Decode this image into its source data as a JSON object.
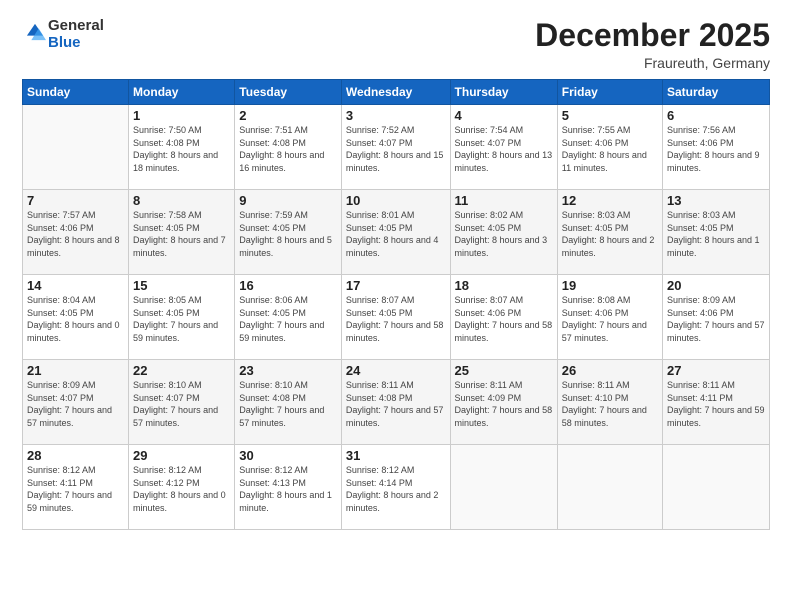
{
  "logo": {
    "general": "General",
    "blue": "Blue"
  },
  "header": {
    "month": "December 2025",
    "location": "Fraureuth, Germany"
  },
  "weekdays": [
    "Sunday",
    "Monday",
    "Tuesday",
    "Wednesday",
    "Thursday",
    "Friday",
    "Saturday"
  ],
  "weeks": [
    [
      {
        "day": "",
        "info": ""
      },
      {
        "day": "1",
        "info": "Sunrise: 7:50 AM\nSunset: 4:08 PM\nDaylight: 8 hours\nand 18 minutes."
      },
      {
        "day": "2",
        "info": "Sunrise: 7:51 AM\nSunset: 4:08 PM\nDaylight: 8 hours\nand 16 minutes."
      },
      {
        "day": "3",
        "info": "Sunrise: 7:52 AM\nSunset: 4:07 PM\nDaylight: 8 hours\nand 15 minutes."
      },
      {
        "day": "4",
        "info": "Sunrise: 7:54 AM\nSunset: 4:07 PM\nDaylight: 8 hours\nand 13 minutes."
      },
      {
        "day": "5",
        "info": "Sunrise: 7:55 AM\nSunset: 4:06 PM\nDaylight: 8 hours\nand 11 minutes."
      },
      {
        "day": "6",
        "info": "Sunrise: 7:56 AM\nSunset: 4:06 PM\nDaylight: 8 hours\nand 9 minutes."
      }
    ],
    [
      {
        "day": "7",
        "info": "Sunrise: 7:57 AM\nSunset: 4:06 PM\nDaylight: 8 hours\nand 8 minutes."
      },
      {
        "day": "8",
        "info": "Sunrise: 7:58 AM\nSunset: 4:05 PM\nDaylight: 8 hours\nand 7 minutes."
      },
      {
        "day": "9",
        "info": "Sunrise: 7:59 AM\nSunset: 4:05 PM\nDaylight: 8 hours\nand 5 minutes."
      },
      {
        "day": "10",
        "info": "Sunrise: 8:01 AM\nSunset: 4:05 PM\nDaylight: 8 hours\nand 4 minutes."
      },
      {
        "day": "11",
        "info": "Sunrise: 8:02 AM\nSunset: 4:05 PM\nDaylight: 8 hours\nand 3 minutes."
      },
      {
        "day": "12",
        "info": "Sunrise: 8:03 AM\nSunset: 4:05 PM\nDaylight: 8 hours\nand 2 minutes."
      },
      {
        "day": "13",
        "info": "Sunrise: 8:03 AM\nSunset: 4:05 PM\nDaylight: 8 hours\nand 1 minute."
      }
    ],
    [
      {
        "day": "14",
        "info": "Sunrise: 8:04 AM\nSunset: 4:05 PM\nDaylight: 8 hours\nand 0 minutes."
      },
      {
        "day": "15",
        "info": "Sunrise: 8:05 AM\nSunset: 4:05 PM\nDaylight: 7 hours\nand 59 minutes."
      },
      {
        "day": "16",
        "info": "Sunrise: 8:06 AM\nSunset: 4:05 PM\nDaylight: 7 hours\nand 59 minutes."
      },
      {
        "day": "17",
        "info": "Sunrise: 8:07 AM\nSunset: 4:05 PM\nDaylight: 7 hours\nand 58 minutes."
      },
      {
        "day": "18",
        "info": "Sunrise: 8:07 AM\nSunset: 4:06 PM\nDaylight: 7 hours\nand 58 minutes."
      },
      {
        "day": "19",
        "info": "Sunrise: 8:08 AM\nSunset: 4:06 PM\nDaylight: 7 hours\nand 57 minutes."
      },
      {
        "day": "20",
        "info": "Sunrise: 8:09 AM\nSunset: 4:06 PM\nDaylight: 7 hours\nand 57 minutes."
      }
    ],
    [
      {
        "day": "21",
        "info": "Sunrise: 8:09 AM\nSunset: 4:07 PM\nDaylight: 7 hours\nand 57 minutes."
      },
      {
        "day": "22",
        "info": "Sunrise: 8:10 AM\nSunset: 4:07 PM\nDaylight: 7 hours\nand 57 minutes."
      },
      {
        "day": "23",
        "info": "Sunrise: 8:10 AM\nSunset: 4:08 PM\nDaylight: 7 hours\nand 57 minutes."
      },
      {
        "day": "24",
        "info": "Sunrise: 8:11 AM\nSunset: 4:08 PM\nDaylight: 7 hours\nand 57 minutes."
      },
      {
        "day": "25",
        "info": "Sunrise: 8:11 AM\nSunset: 4:09 PM\nDaylight: 7 hours\nand 58 minutes."
      },
      {
        "day": "26",
        "info": "Sunrise: 8:11 AM\nSunset: 4:10 PM\nDaylight: 7 hours\nand 58 minutes."
      },
      {
        "day": "27",
        "info": "Sunrise: 8:11 AM\nSunset: 4:11 PM\nDaylight: 7 hours\nand 59 minutes."
      }
    ],
    [
      {
        "day": "28",
        "info": "Sunrise: 8:12 AM\nSunset: 4:11 PM\nDaylight: 7 hours\nand 59 minutes."
      },
      {
        "day": "29",
        "info": "Sunrise: 8:12 AM\nSunset: 4:12 PM\nDaylight: 8 hours\nand 0 minutes."
      },
      {
        "day": "30",
        "info": "Sunrise: 8:12 AM\nSunset: 4:13 PM\nDaylight: 8 hours\nand 1 minute."
      },
      {
        "day": "31",
        "info": "Sunrise: 8:12 AM\nSunset: 4:14 PM\nDaylight: 8 hours\nand 2 minutes."
      },
      {
        "day": "",
        "info": ""
      },
      {
        "day": "",
        "info": ""
      },
      {
        "day": "",
        "info": ""
      }
    ]
  ]
}
